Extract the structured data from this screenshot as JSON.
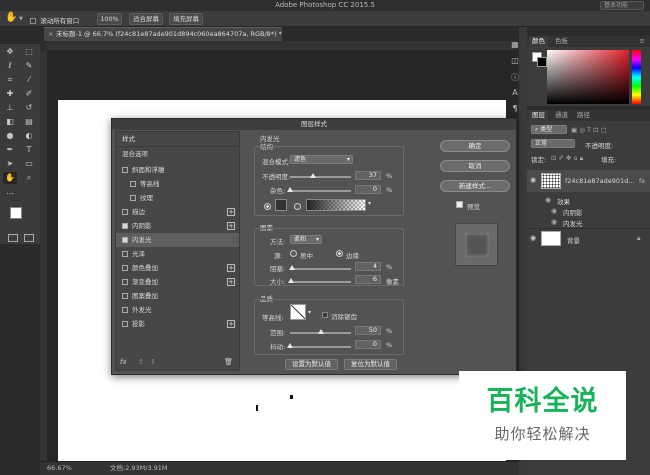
{
  "app_title": "Adobe Photoshop CC 2015.5",
  "search_placeholder": "基本功能",
  "options_bar": {
    "scroll_all_label": "滚动所有窗口",
    "zoom_btn": "100%",
    "fit_screen_btn": "适合屏幕",
    "fill_screen_btn": "填充屏幕"
  },
  "doc_tab": "未标题-1 @ 66.7% (f24c81e87ade901d894c060ea864707a, RGB/8*) *",
  "status": {
    "zoom": "66.67%",
    "doc_info": "文档:2.93M/3.91M"
  },
  "color_panel": {
    "tabs": [
      "颜色",
      "色板"
    ]
  },
  "layers_panel": {
    "tabs": [
      "图层",
      "通道",
      "路径"
    ],
    "kind_filter": "类型",
    "blend_mode": "正常",
    "opacity_label": "不透明度:",
    "lock_label": "锁定:",
    "fill_label": "填充:",
    "layer_name": "f24c81e87ade901d...",
    "effects_label": "效果",
    "effect_items": [
      "内阴影",
      "内发光"
    ],
    "bg_layer": "背景"
  },
  "dialog": {
    "title": "图层样式",
    "styles_header": "样式",
    "blend_options": "混合选项",
    "style_items": [
      {
        "label": "斜面和浮雕",
        "checked": false,
        "plus": false,
        "indent": false
      },
      {
        "label": "等高线",
        "checked": false,
        "plus": false,
        "indent": true
      },
      {
        "label": "纹理",
        "checked": false,
        "plus": false,
        "indent": true
      },
      {
        "label": "描边",
        "checked": false,
        "plus": true,
        "indent": false
      },
      {
        "label": "内阴影",
        "checked": true,
        "plus": true,
        "indent": false
      },
      {
        "label": "内发光",
        "checked": true,
        "plus": false,
        "indent": false
      },
      {
        "label": "光泽",
        "checked": false,
        "plus": false,
        "indent": false
      },
      {
        "label": "颜色叠加",
        "checked": false,
        "plus": true,
        "indent": false
      },
      {
        "label": "渐变叠加",
        "checked": false,
        "plus": true,
        "indent": false
      },
      {
        "label": "图案叠加",
        "checked": false,
        "plus": false,
        "indent": false
      },
      {
        "label": "外发光",
        "checked": false,
        "plus": false,
        "indent": false
      },
      {
        "label": "投影",
        "checked": false,
        "plus": true,
        "indent": false
      }
    ],
    "section_title": "内发光",
    "structure": {
      "title": "结构",
      "blend_mode_label": "混合模式:",
      "blend_mode_value": "滤色",
      "opacity_label": "不透明度:",
      "opacity_value": "37",
      "opacity_fraction": 0.37,
      "noise_label": "杂色:",
      "noise_value": "0",
      "noise_fraction": 0.0,
      "percent": "%"
    },
    "elements": {
      "title": "图素",
      "method_label": "方法:",
      "method_value": "柔和",
      "source_label": "源:",
      "center_label": "居中",
      "edge_label": "边缘",
      "choke_label": "阻塞:",
      "choke_value": "4",
      "choke_fraction": 0.04,
      "size_label": "大小:",
      "size_value": "6",
      "size_unit": "像素",
      "size_fraction": 0.024,
      "percent": "%"
    },
    "quality": {
      "title": "品质",
      "contour_label": "等高线:",
      "antialias_label": "消除锯齿",
      "range_label": "范围:",
      "range_value": "50",
      "range_fraction": 0.5,
      "jitter_label": "抖动:",
      "jitter_value": "0",
      "jitter_fraction": 0.0,
      "percent": "%"
    },
    "set_default_btn": "设置为默认值",
    "reset_default_btn": "复位为默认值",
    "ok_btn": "确定",
    "cancel_btn": "取消",
    "new_style_btn": "新建样式...",
    "preview_label": "预览",
    "fx_label": "fx"
  },
  "watermark": {
    "title": "百科全说",
    "subtitle": "助你轻松解决"
  },
  "colors": {
    "accent_green": "#17b25a",
    "dialog_bg": "#535353",
    "panel_bg": "#3c3c3c"
  }
}
